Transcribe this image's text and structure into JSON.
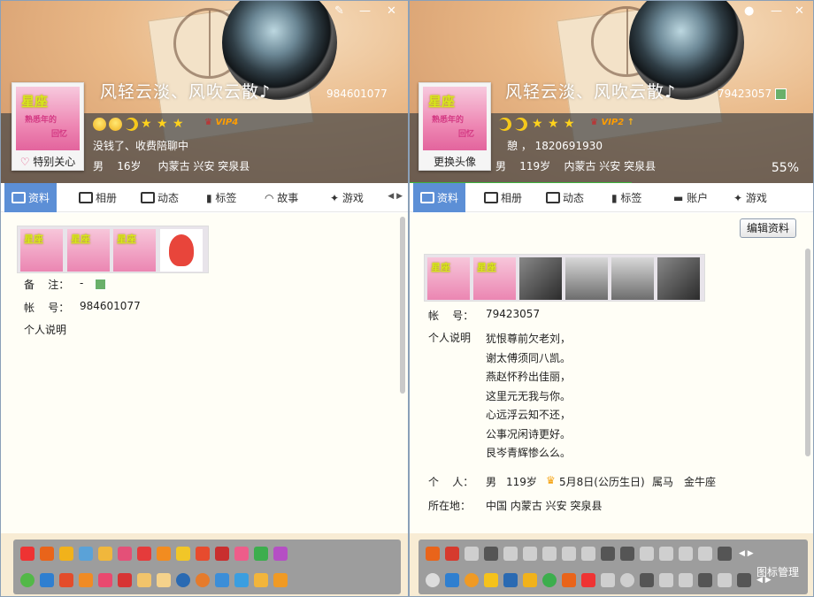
{
  "left": {
    "nickname": "风轻云淡、风吹云散♪",
    "qq": "984601077",
    "status": "没钱了、收费陪聊中",
    "gender": "男",
    "age": "16岁",
    "location": "内蒙古 兴安 突泉县",
    "avatar_label": "特别关心",
    "avatar_text": [
      "星座",
      "熟悉年的",
      "回忆"
    ],
    "vip": "VIP4",
    "tabs": [
      "资料",
      "相册",
      "动态",
      "标签",
      "故事",
      "游戏"
    ],
    "remark_label": "备    注：",
    "remark_value": "-",
    "account_label": "帐    号：",
    "account_value": "984601077",
    "bio_label": "个人说明",
    "window_controls": [
      "paintbrush-icon",
      "minimize-icon",
      "close-icon"
    ]
  },
  "right": {
    "nickname": "风轻云淡、风吹云散♪",
    "qq": "79423057",
    "status": "憩 ，  1820691930",
    "gender": "男",
    "age": "119岁",
    "location": "内蒙古 兴安 突泉县",
    "avatar_label": "更换头像",
    "vip": "VIP2",
    "progress_text": "55%",
    "progress_value": 0.55,
    "tabs": [
      "资料",
      "相册",
      "动态",
      "标签",
      "账户",
      "游戏"
    ],
    "edit_button": "编辑资料",
    "account_label": "帐    号：",
    "account_value": "79423057",
    "bio_label": "个人说明",
    "bio_lines": [
      "犹恨尊前欠老刘，",
      "谢太傅须同八凯。",
      "燕赵怀矜出佳丽，",
      "这里元无我与你。",
      "心远浮云知不还，",
      "公事况闲诗更好。",
      "艮岑青辉惨么么。"
    ],
    "personal_label": "个    人：",
    "personal_gender": "男",
    "personal_age": "119岁",
    "birthday": "5月8日(公历生日)",
    "zodiac": "属马",
    "constellation": "金牛座",
    "location_label": "所在地：",
    "location_full": "中国 内蒙古 兴安 突泉县",
    "icon_manager": "图标管理",
    "window_controls": [
      "skin-icon",
      "minimize-icon",
      "close-icon"
    ]
  },
  "colors": {
    "tab_active": "#5c8fd6",
    "band": "#464646",
    "content_bg": "#fffef6",
    "footer_bg": "#f8ecd4",
    "progress": "#3db23d"
  }
}
